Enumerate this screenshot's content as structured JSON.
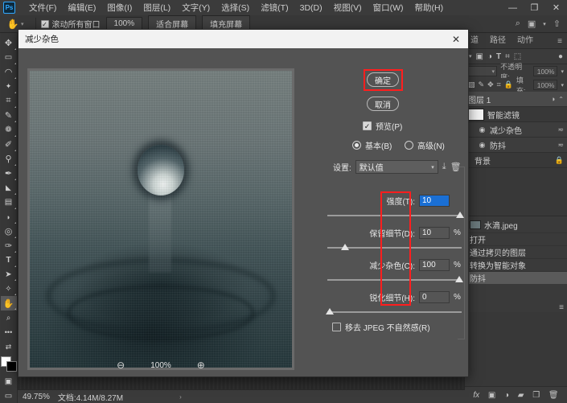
{
  "app": {
    "logo": "Ps",
    "menus": [
      "文件(F)",
      "编辑(E)",
      "图像(I)",
      "图层(L)",
      "文字(Y)",
      "选择(S)",
      "滤镜(T)",
      "3D(D)",
      "视图(V)",
      "窗口(W)",
      "帮助(H)"
    ],
    "window_buttons": [
      {
        "name": "minimize",
        "glyph": "—"
      },
      {
        "name": "restore",
        "glyph": "❐"
      },
      {
        "name": "close",
        "glyph": "✕"
      }
    ]
  },
  "options_bar": {
    "tool_icon": "hand-icon",
    "scroll_all_windows": {
      "label": "滚动所有窗口",
      "checked": true
    },
    "buttons": [
      "100%",
      "适合屏幕",
      "填充屏幕"
    ],
    "right_icons": [
      "search-icon",
      "workspace-icon",
      "chevron-down-icon",
      "share-icon"
    ]
  },
  "toolbar": {
    "tools": [
      {
        "name": "move-tool",
        "glyph": "✥",
        "active": false
      },
      {
        "name": "marquee-tool",
        "glyph": "▭",
        "active": false
      },
      {
        "name": "lasso-tool",
        "glyph": "◠",
        "active": false
      },
      {
        "name": "magic-wand-tool",
        "glyph": "✦",
        "active": false
      },
      {
        "name": "crop-tool",
        "glyph": "⌗",
        "active": false
      },
      {
        "name": "eyedropper-tool",
        "glyph": "✎",
        "active": false
      },
      {
        "name": "healing-brush-tool",
        "glyph": "❁",
        "active": false
      },
      {
        "name": "brush-tool",
        "glyph": "✐",
        "active": false
      },
      {
        "name": "clone-stamp-tool",
        "glyph": "⚲",
        "active": false
      },
      {
        "name": "history-brush-tool",
        "glyph": "✒",
        "active": false
      },
      {
        "name": "eraser-tool",
        "glyph": "◣",
        "active": false
      },
      {
        "name": "gradient-tool",
        "glyph": "▤",
        "active": false
      },
      {
        "name": "blur-tool",
        "glyph": "💧",
        "active": false
      },
      {
        "name": "dodge-tool",
        "glyph": "◎",
        "active": false
      },
      {
        "name": "pen-tool",
        "glyph": "✑",
        "active": false
      },
      {
        "name": "type-tool",
        "glyph": "T",
        "active": false
      },
      {
        "name": "path-selection-tool",
        "glyph": "➤",
        "active": false
      },
      {
        "name": "shape-tool",
        "glyph": "✧",
        "active": false
      },
      {
        "name": "hand-tool",
        "glyph": "✋",
        "active": true
      },
      {
        "name": "zoom-tool",
        "glyph": "🔍",
        "active": false
      },
      {
        "name": "more-tools",
        "glyph": "•••",
        "active": false
      },
      {
        "name": "edit-toolbar",
        "glyph": "⇄",
        "active": false
      }
    ],
    "foreground_color": "#ffffff",
    "background_color": "#000000",
    "quick_mask": "▣"
  },
  "status_bar": {
    "zoom": "49.75%",
    "doc_label": "文档:4.14M/8.27M",
    "caret": "›"
  },
  "dialog": {
    "title": "减少杂色",
    "close_glyph": "✕",
    "ok_label": "确定",
    "cancel_label": "取消",
    "preview": {
      "label": "预览(P)",
      "checked": true
    },
    "modes": [
      {
        "label": "基本(B)",
        "selected": true
      },
      {
        "label": "高级(N)",
        "selected": false
      }
    ],
    "settings": {
      "label": "设置:",
      "value": "默认值",
      "save_icon": "save-preset-icon",
      "delete_icon": "trash-icon"
    },
    "sliders": [
      {
        "name": "strength",
        "label": "强度(T):",
        "value": "10",
        "unit": "",
        "thumb_pct": 100,
        "selected": true
      },
      {
        "name": "preserve-details",
        "label": "保留细节(D):",
        "value": "10",
        "unit": "%",
        "thumb_pct": 10,
        "selected": false
      },
      {
        "name": "reduce-color-noise",
        "label": "减少杂色(C):",
        "value": "100",
        "unit": "%",
        "thumb_pct": 99,
        "selected": false
      },
      {
        "name": "sharpen-details",
        "label": "锐化细节(H):",
        "value": "0",
        "unit": "%",
        "thumb_pct": 0,
        "selected": false
      }
    ],
    "jpeg_artifact": {
      "label": "移去 JPEG 不自然感(R)",
      "checked": false
    },
    "zoom_controls": {
      "zoom_out": "zoom-out-icon",
      "percent": "100%",
      "zoom_in": "zoom-in-icon"
    },
    "highlight_color": "#ff1e1e"
  },
  "panels": {
    "tabs": [
      {
        "label": "道",
        "active": false
      },
      {
        "label": "路径",
        "active": false
      },
      {
        "label": "动作",
        "active": false
      }
    ],
    "menu_glyph": "≡",
    "filter_icons": [
      "image-filter-icon",
      "adjustment-filter-icon",
      "type-filter-icon",
      "shape-filter-icon",
      "smart-filter-icon",
      "toggle-filters-icon"
    ],
    "blend": {
      "opacity_label": "不透明度:",
      "opacity_value": "100%",
      "fill_label": "填充:",
      "fill_value": "100%"
    },
    "lock_icons": [
      "lock-transparent-icon",
      "lock-image-icon",
      "lock-position-icon",
      "lock-artboard-icon",
      "lock-all-icon"
    ],
    "layers": [
      {
        "name": "图层 1",
        "type": "layer",
        "selected": true,
        "badge": "◑",
        "chevron": "⌃"
      },
      {
        "name": "智能滤镜",
        "type": "smart-filter-header",
        "selected": false,
        "badge": ""
      },
      {
        "name": "减少杂色",
        "type": "smart-filter",
        "selected": false,
        "badge": "≂"
      },
      {
        "name": "防抖",
        "type": "smart-filter",
        "selected": false,
        "badge": "≂"
      },
      {
        "name": "背景",
        "type": "layer",
        "selected": false,
        "badge": "🔒"
      }
    ],
    "footer_icons": [
      "fx-icon",
      "mask-icon",
      "adjustment-icon",
      "group-icon",
      "new-layer-icon",
      "delete-layer-icon"
    ]
  },
  "history": {
    "source_name": "水滴.jpeg",
    "items": [
      {
        "label": "打开",
        "current": false
      },
      {
        "label": "通过拷贝的图层",
        "current": false
      },
      {
        "label": "转换为智能对象",
        "current": false
      },
      {
        "label": "防抖",
        "current": true
      }
    ],
    "menu_glyph": "≡"
  }
}
